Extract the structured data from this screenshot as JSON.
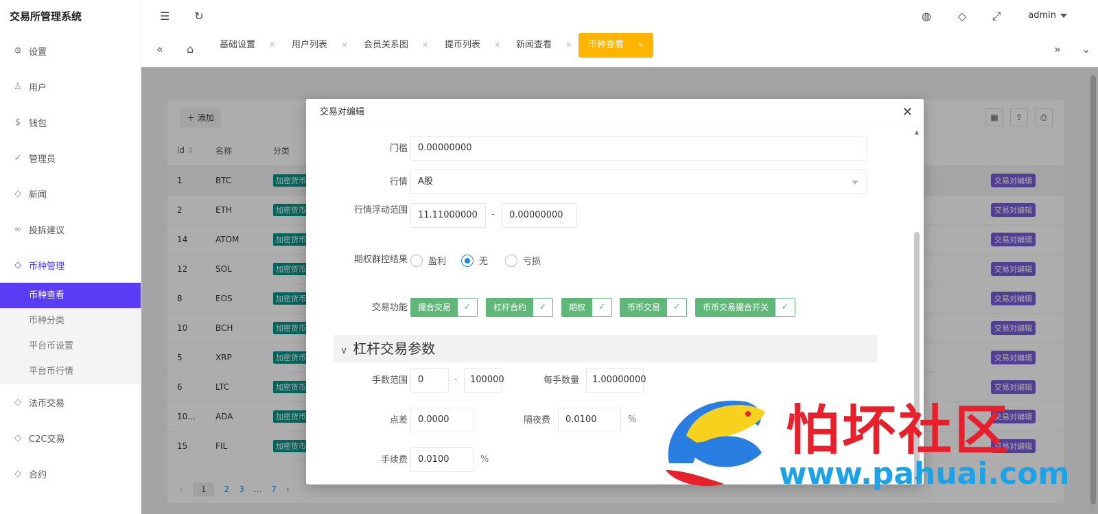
{
  "app": {
    "title": "交易所管理系统"
  },
  "topbar": {
    "user": "admin"
  },
  "sidebar": {
    "items": [
      {
        "label": "设置"
      },
      {
        "label": "用户"
      },
      {
        "label": "钱包"
      },
      {
        "label": "管理员"
      },
      {
        "label": "新闻"
      },
      {
        "label": "投拆建议"
      },
      {
        "label": "币种管理"
      }
    ],
    "sub_items": [
      {
        "label": "币种查看"
      },
      {
        "label": "币种分类"
      },
      {
        "label": "平台币设置"
      },
      {
        "label": "平台币行情"
      }
    ],
    "bottom_items": [
      {
        "label": "法币交易"
      },
      {
        "label": "C2C交易"
      },
      {
        "label": "合约"
      }
    ]
  },
  "tabs": [
    {
      "label": "基础设置"
    },
    {
      "label": "用户列表"
    },
    {
      "label": "会员关系图"
    },
    {
      "label": "提币列表"
    },
    {
      "label": "新闻查看"
    },
    {
      "label": "币种查看"
    }
  ],
  "table": {
    "add_label": "添加",
    "headers": {
      "id": "id",
      "name": "名称",
      "category": "分类"
    },
    "category_text": "加密货币",
    "edit_text": "交易对编辑",
    "rows": [
      {
        "id": "1",
        "name": "BTC"
      },
      {
        "id": "2",
        "name": "ETH"
      },
      {
        "id": "14",
        "name": "ATOM"
      },
      {
        "id": "12",
        "name": "SOL"
      },
      {
        "id": "8",
        "name": "EOS"
      },
      {
        "id": "10",
        "name": "BCH"
      },
      {
        "id": "5",
        "name": "XRP"
      },
      {
        "id": "6",
        "name": "LTC"
      },
      {
        "id": "10...",
        "name": "ADA"
      },
      {
        "id": "15",
        "name": "FIL"
      }
    ],
    "pager": {
      "current": "1",
      "p2": "2",
      "p3": "3",
      "ellipsis": "...",
      "last": "7"
    }
  },
  "modal": {
    "title": "交易对编辑",
    "threshold": {
      "label": "门槛",
      "value": "0.00000000"
    },
    "market": {
      "label": "行情",
      "value": "A股"
    },
    "float_range": {
      "label": "行情浮动范围",
      "min": "11.11000000",
      "max": "0.00000000"
    },
    "option_control": {
      "label": "期权群控结果",
      "options": [
        "盈利",
        "无",
        "亏损"
      ],
      "selected": "无"
    },
    "trade_functions": {
      "label": "交易功能",
      "items": [
        "撮合交易",
        "杠杆合约",
        "期权",
        "币币交易",
        "币币交易撮合开关"
      ]
    },
    "leverage_section": {
      "title": "杠杆交易参数"
    },
    "lot_range": {
      "label": "手数范围",
      "min": "0",
      "max": "100000"
    },
    "per_lot": {
      "label": "每手数量",
      "value": "1.00000000"
    },
    "spread": {
      "label": "点差",
      "value": "0.0000"
    },
    "overnight_fee": {
      "label": "隔夜费",
      "value": "0.0100",
      "unit": "%"
    },
    "fee": {
      "label": "手续费",
      "value": "0.0100",
      "unit": "%"
    }
  },
  "watermark": {
    "title": "怕坏社区",
    "url": "www.pahuai.com"
  },
  "colors": {
    "accent": "#5b3cf5",
    "tab_active": "#ffb400",
    "switch_on": "#5fb878",
    "badge_category": "#009688",
    "badge_edit": "#7a5cd8"
  }
}
